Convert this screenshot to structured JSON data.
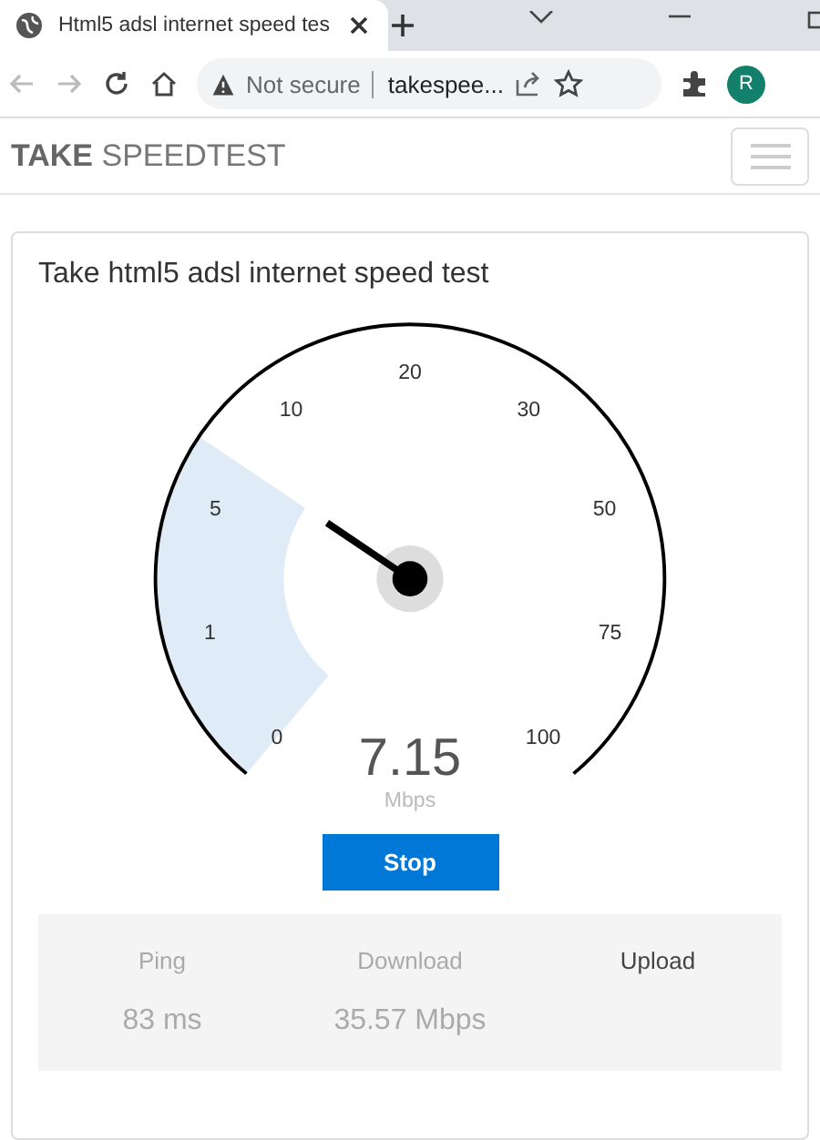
{
  "browser": {
    "tab_title": "Html5 adsl internet speed tes",
    "security": "Not secure",
    "address": "takespee...",
    "avatar": "R"
  },
  "navbar": {
    "brand": "**TAKE** SPEEDTEST"
  },
  "card": {
    "title": "Take html5 adsl internet speed test"
  },
  "gauge": {
    "ticks": [
      "0",
      "1",
      "5",
      "10",
      "20",
      "30",
      "50",
      "75",
      "100"
    ],
    "reading": "7.15",
    "unit": "Mbps"
  },
  "button": {
    "label": "Stop"
  },
  "stats": [
    {
      "label": "Ping",
      "value": "83 ms",
      "active": false
    },
    {
      "label": "Download",
      "value": "35.57 Mbps",
      "active": false
    },
    {
      "label": "Upload",
      "active": true
    }
  ]
}
